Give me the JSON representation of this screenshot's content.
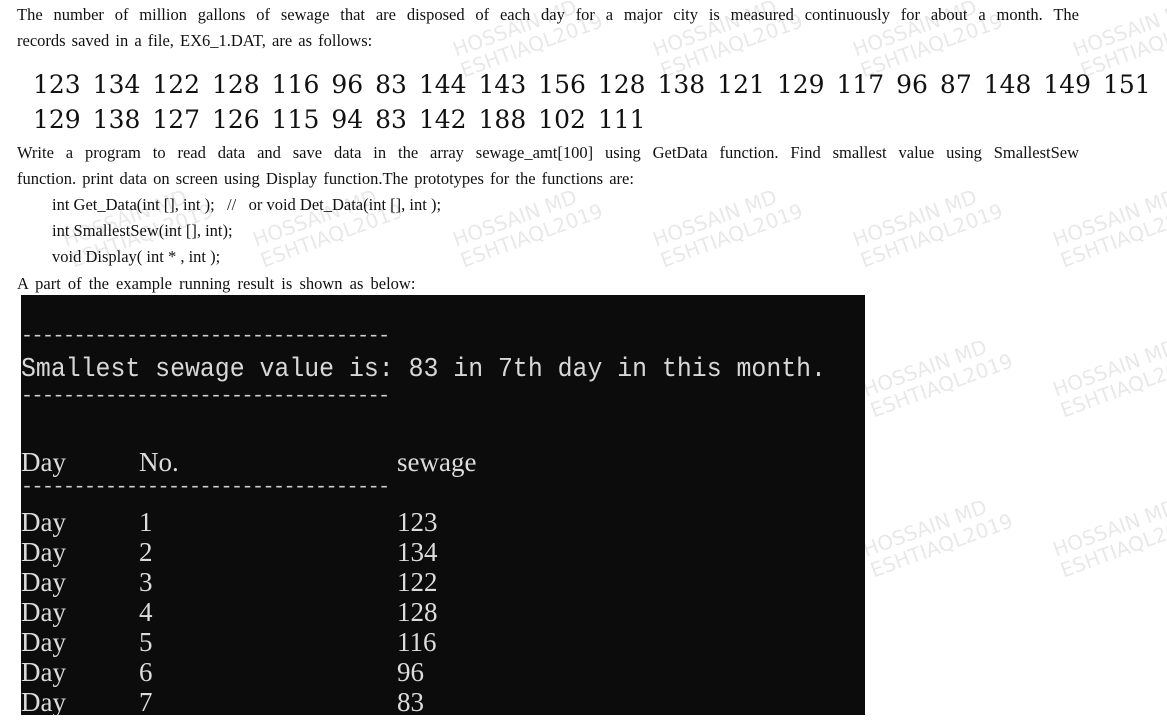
{
  "problem": {
    "intro_line1": "The number of million gallons of sewage that are disposed of each day for a major city is measured continuously for about a month. The",
    "intro_line2": "records saved in a file, EX6_1.DAT, are as follows:",
    "data_row1": "123 134 122 128 116 96 83 144 143 156 128 138 121 129 117 96 87 148 149 151",
    "data_row2": "129 138 127 126 115 94 83 142 188 102 111",
    "task_line1": "Write a program to read data and save data in the array sewage_amt[100] using GetData function. Find smallest value using SmallestSew",
    "task_line2": "function. print data on screen using Display function.The prototypes for the functions are:",
    "prototypes": [
      "int Get_Data(int [], int );   //   or void Det_Data(int [], int );",
      "int SmallestSew(int [], int);",
      "void Display( int * , int );"
    ],
    "example_caption": "A part of the example running result is shown as below:"
  },
  "console": {
    "separator": "-----------------------------------",
    "smallest_message": "Smallest sewage value is: 83 in 7th day in this month.",
    "headers": {
      "day": "Day",
      "no": "No.",
      "sewage": "sewage"
    },
    "rows": [
      {
        "day": "Day",
        "no": "1",
        "sewage": "123"
      },
      {
        "day": "Day",
        "no": "2",
        "sewage": "134"
      },
      {
        "day": "Day",
        "no": "3",
        "sewage": "122"
      },
      {
        "day": "Day",
        "no": "4",
        "sewage": "128"
      },
      {
        "day": "Day",
        "no": "5",
        "sewage": "116"
      },
      {
        "day": "Day",
        "no": "6",
        "sewage": "96"
      },
      {
        "day": "Day",
        "no": "7",
        "sewage": "83"
      }
    ]
  },
  "watermark": {
    "line1": "HOSSAIN MD",
    "line2": "ESHTIAQL2019"
  }
}
